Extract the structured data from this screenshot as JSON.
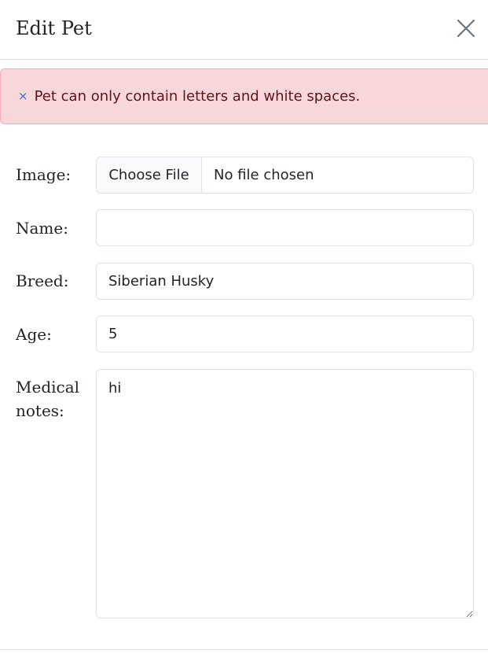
{
  "modal": {
    "title": "Edit Pet",
    "close_icon": "close-icon"
  },
  "alert": {
    "icon": "×",
    "message": "Pet can only contain letters and white spaces."
  },
  "form": {
    "image": {
      "label": "Image:",
      "button_label": "Choose File",
      "status": "No file chosen"
    },
    "name": {
      "label": "Name:",
      "value": ""
    },
    "breed": {
      "label": "Breed:",
      "value": "Siberian Husky"
    },
    "age": {
      "label": "Age:",
      "value": "5"
    },
    "medical_notes": {
      "label_line1": "Medical",
      "label_line2": "notes:",
      "value": "hi"
    }
  },
  "colors": {
    "alert_bg": "#f8d7da",
    "alert_border": "#f1aeb5",
    "alert_text": "#58151c",
    "alert_icon": "#3d6bd6",
    "border": "#dee2e6"
  }
}
